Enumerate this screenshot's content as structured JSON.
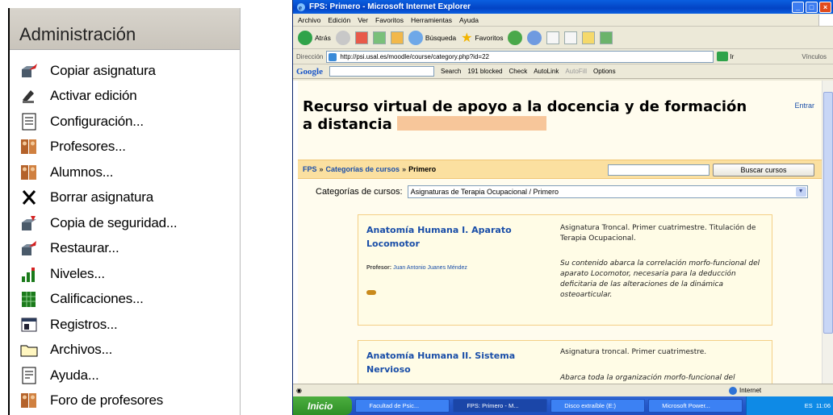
{
  "admin": {
    "title": "Administración",
    "items": [
      {
        "label": "Copiar asignatura",
        "icon": "copy-course-icon"
      },
      {
        "label": "Activar edición",
        "icon": "edit-icon"
      },
      {
        "label": "Configuración...",
        "icon": "settings-icon"
      },
      {
        "label": "Profesores...",
        "icon": "teachers-icon"
      },
      {
        "label": "Alumnos...",
        "icon": "students-icon"
      },
      {
        "label": "Borrar asignatura",
        "icon": "delete-icon"
      },
      {
        "label": "Copia de seguridad...",
        "icon": "backup-icon"
      },
      {
        "label": "Restaurar...",
        "icon": "restore-icon"
      },
      {
        "label": "Niveles...",
        "icon": "scales-icon"
      },
      {
        "label": "Calificaciones...",
        "icon": "grades-icon"
      },
      {
        "label": "Registros...",
        "icon": "logs-icon"
      },
      {
        "label": "Archivos...",
        "icon": "folder-icon"
      },
      {
        "label": "Ayuda...",
        "icon": "help-icon"
      },
      {
        "label": "Foro de profesores",
        "icon": "forum-icon"
      }
    ]
  },
  "browser": {
    "title": "FPS: Primero - Microsoft Internet Explorer",
    "menu": [
      "Archivo",
      "Edición",
      "Ver",
      "Favoritos",
      "Herramientas",
      "Ayuda"
    ],
    "toolbar": {
      "back": "Atrás",
      "search": "Búsqueda",
      "favorites": "Favoritos"
    },
    "address_label": "Dirección",
    "address": "http://psi.usal.es/moodle/course/category.php?id=22",
    "go": "Ir",
    "links": "Vínculos",
    "google": {
      "logo": "Google",
      "search": "Search",
      "blocked": "191 blocked",
      "check": "Check",
      "autolink": "AutoLink",
      "autofill": "AutoFill",
      "options": "Options"
    },
    "status_zone": "Internet"
  },
  "page": {
    "site_title": "Recurso virtual de apoyo a la docencia y de formación a distancia",
    "login": "Entrar",
    "breadcrumb": {
      "root": "FPS",
      "sep": "»",
      "categories": "Categorías de cursos",
      "current": "Primero"
    },
    "search_button": "Buscar cursos",
    "category_label": "Categorías de cursos:",
    "category_value": "Asignaturas de Terapia Ocupacional / Primero",
    "courses": [
      {
        "name": "Anatomía Humana I. Aparato Locomotor",
        "teacher_label": "Profesor:",
        "teacher": "Juan Antonio Juanes Méndez",
        "info": "Asignatura Troncal. Primer cuatrimestre. Titulación de Terapia Ocupacional.",
        "desc": "Su contenido abarca la correlación morfo-funcional del aparato Locomotor, necesaria para la deducción deficitaria de las alteraciones de la dinámica osteoarticular."
      },
      {
        "name": "Anatomía Humana II. Sistema Nervioso",
        "info": "Asignatura troncal. Primer cuatrimestre.",
        "desc": "Abarca toda la organización morfo-funcional del"
      }
    ]
  },
  "taskbar": {
    "start": "Inicio",
    "tasks": [
      "Facultad de Psic...",
      "FPS: Primero - M...",
      "Disco extraíble (E:)",
      "Microsoft Power..."
    ],
    "tray_text": "ES",
    "clock": "11:06"
  }
}
